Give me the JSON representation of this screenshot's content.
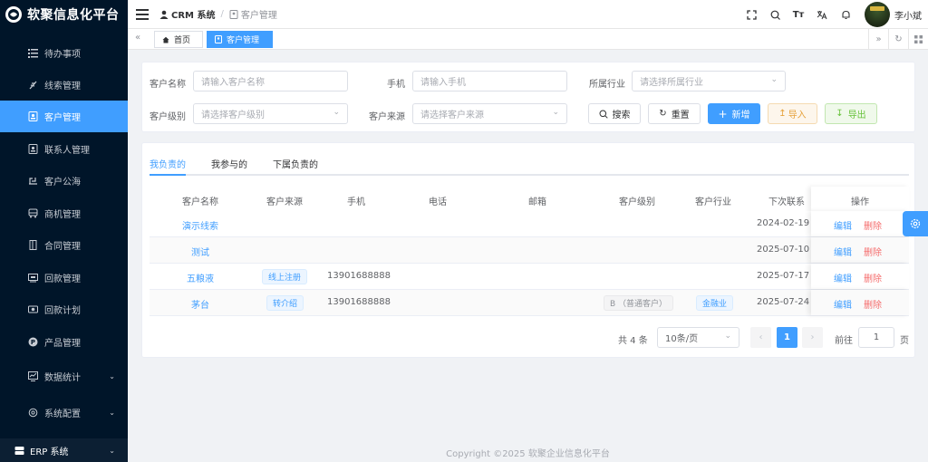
{
  "app": {
    "title": "软聚信息化平台",
    "footer": "Copyright ©2025 软聚企业信息化平台"
  },
  "sidebar": {
    "items": [
      {
        "label": "待办事项",
        "icon": "list-icon"
      },
      {
        "label": "线索管理",
        "icon": "leaf-icon"
      },
      {
        "label": "客户管理",
        "icon": "contact-card-icon",
        "active": true
      },
      {
        "label": "联系人管理",
        "icon": "contact-card-icon"
      },
      {
        "label": "客户公海",
        "icon": "sea-icon"
      },
      {
        "label": "商机管理",
        "icon": "bus-icon"
      },
      {
        "label": "合同管理",
        "icon": "document-icon"
      },
      {
        "label": "回款管理",
        "icon": "receipt-icon"
      },
      {
        "label": "回款计划",
        "icon": "money-icon"
      },
      {
        "label": "产品管理",
        "icon": "product-p-icon"
      },
      {
        "label": "数据统计",
        "icon": "chart-icon",
        "expandable": true
      },
      {
        "label": "系统配置",
        "icon": "settings-icon",
        "expandable": true
      }
    ],
    "erp_label": "ERP 系统"
  },
  "header": {
    "crumb_root": "CRM 系统",
    "crumb_current": "客户管理",
    "user_name": "李小斌"
  },
  "tags": {
    "home": "首页",
    "current": "客户管理"
  },
  "filters": {
    "name_label": "客户名称",
    "name_placeholder": "请输入客户名称",
    "phone_label": "手机",
    "phone_placeholder": "请输入手机",
    "industry_label": "所属行业",
    "industry_placeholder": "请选择所属行业",
    "level_label": "客户级别",
    "level_placeholder": "请选择客户级别",
    "source_label": "客户来源",
    "source_placeholder": "请选择客户来源",
    "search_btn": "搜索",
    "reset_btn": "重置",
    "add_btn": "新增",
    "import_btn": "导入",
    "export_btn": "导出"
  },
  "tabs": [
    "我负责的",
    "我参与的",
    "下属负责的"
  ],
  "table": {
    "headers": [
      "客户名称",
      "客户来源",
      "手机",
      "电话",
      "邮箱",
      "客户级别",
      "客户行业",
      "下次联系",
      "操作"
    ],
    "edit_label": "编辑",
    "delete_label": "删除",
    "rows": [
      {
        "name": "演示线索",
        "source": "",
        "phone": "",
        "tel": "",
        "email": "",
        "level": "",
        "industry": "",
        "next": "2024-02-19"
      },
      {
        "name": "测试",
        "source": "",
        "phone": "",
        "tel": "",
        "email": "",
        "level": "",
        "industry": "",
        "next": "2025-07-10"
      },
      {
        "name": "五粮液",
        "source": "线上注册",
        "phone": "13901688888",
        "tel": "",
        "email": "",
        "level": "",
        "industry": "",
        "next": "2025-07-17"
      },
      {
        "name": "茅台",
        "source": "转介绍",
        "phone": "13901688888",
        "tel": "",
        "email": "",
        "level": "B （普通客户）",
        "industry": "金融业",
        "next": "2025-07-24"
      }
    ]
  },
  "pagination": {
    "total": "共 4 条",
    "page_size": "10条/页",
    "current_page": "1",
    "goto_label": "前往",
    "goto_value": "1",
    "goto_unit": "页"
  },
  "colors": {
    "primary": "#409eff",
    "sidebar_bg": "#001529",
    "danger": "#f56c6c",
    "warning": "#e6a23c",
    "success": "#67c23a"
  }
}
